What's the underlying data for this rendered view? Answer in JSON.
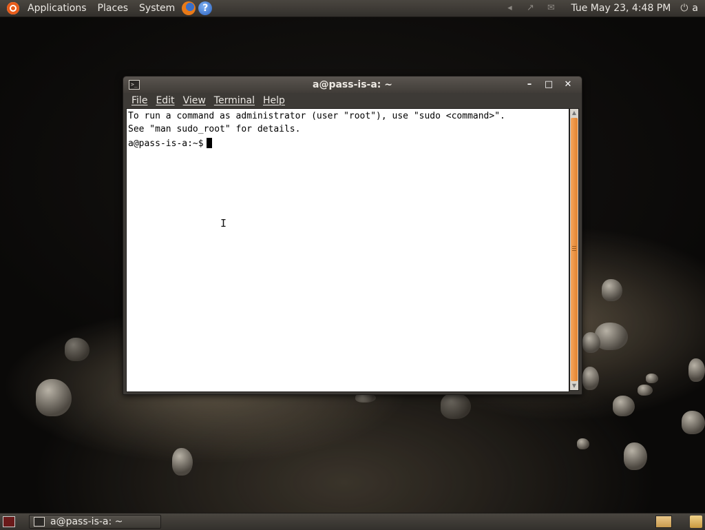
{
  "top_panel": {
    "menus": [
      "Applications",
      "Places",
      "System"
    ],
    "launchers": [
      {
        "icon": "firefox-icon"
      },
      {
        "icon": "help-icon",
        "glyph": "?"
      }
    ],
    "tray": [
      {
        "icon": "volume-icon",
        "glyph": "◂"
      },
      {
        "icon": "network-icon",
        "glyph": "↗"
      },
      {
        "icon": "mail-icon",
        "glyph": "✉"
      }
    ],
    "clock": "Tue May 23,  4:48 PM",
    "power_glyph": "⏻",
    "user": "a"
  },
  "window": {
    "title": "a@pass-is-a: ~",
    "controls": {
      "minimize": "–",
      "maximize": "□",
      "close": "✕"
    },
    "menu": [
      "File",
      "Edit",
      "View",
      "Terminal",
      "Help"
    ],
    "terminal": {
      "lines": [
        "To run a command as administrator (user \"root\"), use \"sudo <command>\".",
        "See \"man sudo_root\" for details.",
        ""
      ],
      "prompt": "a@pass-is-a:~$"
    }
  },
  "bottom_panel": {
    "task_label": "a@pass-is-a: ~"
  },
  "colors": {
    "scroll_thumb": "#e2832e",
    "ubuntu_orange": "#e85c1a"
  }
}
